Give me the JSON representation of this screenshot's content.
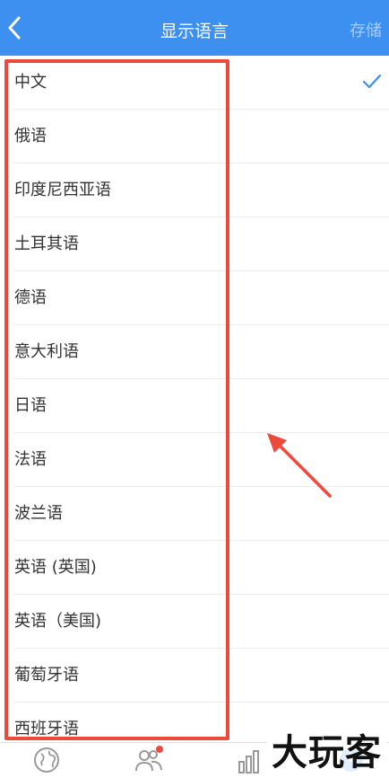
{
  "navbar": {
    "title": "显示语言",
    "save_label": "存储",
    "back_icon": "chevron-left-icon",
    "background_color": "#3d8ff0"
  },
  "languages": [
    {
      "label": "中文",
      "selected": true
    },
    {
      "label": "俄语",
      "selected": false
    },
    {
      "label": "印度尼西亚语",
      "selected": false
    },
    {
      "label": "土耳其语",
      "selected": false
    },
    {
      "label": "德语",
      "selected": false
    },
    {
      "label": "意大利语",
      "selected": false
    },
    {
      "label": "日语",
      "selected": false
    },
    {
      "label": "法语",
      "selected": false
    },
    {
      "label": "波兰语",
      "selected": false
    },
    {
      "label": "英语 (英国)",
      "selected": false
    },
    {
      "label": "英语（美国)",
      "selected": false
    },
    {
      "label": "葡萄牙语",
      "selected": false
    },
    {
      "label": "西班牙语",
      "selected": false
    }
  ],
  "check_color": "#3d8ff0",
  "annotation_color": "#ec4a3b",
  "tabbar": {
    "tabs": [
      {
        "icon": "globe-icon"
      },
      {
        "icon": "people-icon",
        "badge": true
      },
      {
        "icon": "bar-chart-icon"
      },
      {
        "icon": "profile-icon"
      }
    ]
  },
  "watermark": {
    "text": "大玩客"
  }
}
